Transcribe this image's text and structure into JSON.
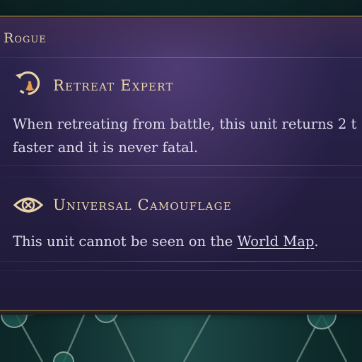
{
  "panel": {
    "class_title": "Rogue"
  },
  "abilities": [
    {
      "icon": "retreat-expert-icon",
      "name": "Retreat Expert",
      "description_lines": [
        "When retreating from battle, this unit returns 2 t",
        "faster and it is never fatal."
      ]
    },
    {
      "icon": "universal-camouflage-icon",
      "name": "Universal Camouflage",
      "description_before_link": "This unit cannot be seen on the ",
      "description_link": "World Map",
      "description_after_link": "."
    }
  ],
  "colors": {
    "title_gold": "#e6d2a6",
    "body_text": "#dcdcea",
    "panel_purple": "#2c2550",
    "map_teal": "#0f2a2c"
  }
}
